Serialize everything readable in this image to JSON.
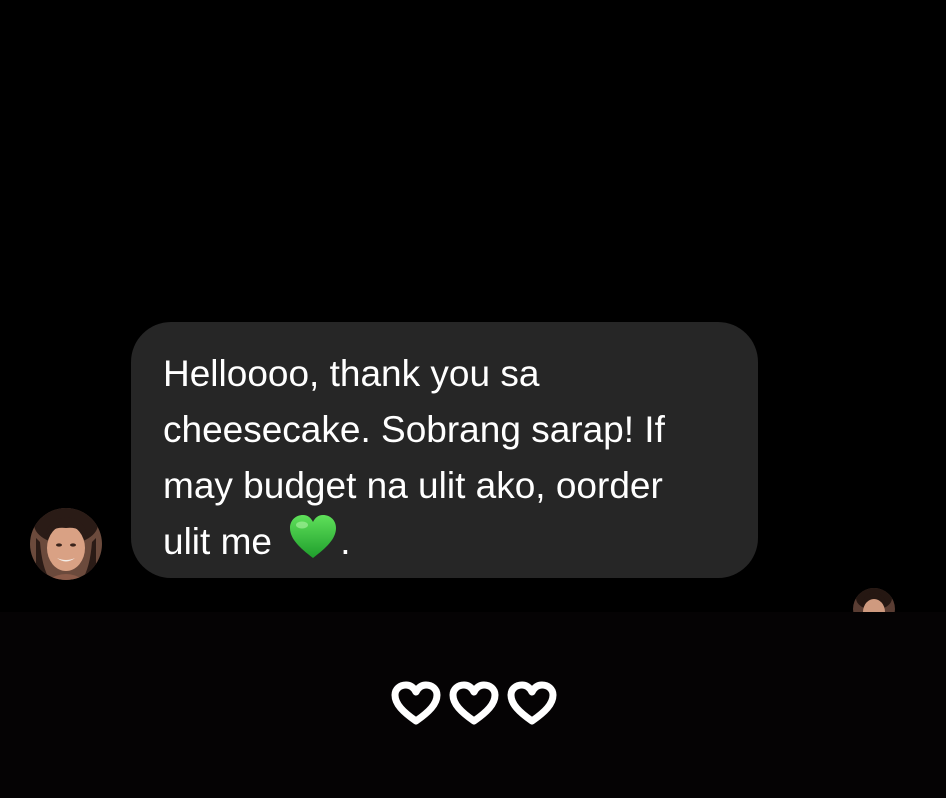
{
  "message": {
    "line1": "Helloooo, thank you sa",
    "line2": "cheesecake. Sobrang sarap! If",
    "line3": "may budget na ulit ako, oorder",
    "line4_before_emoji": "ulit me ",
    "line4_after_emoji": ".",
    "emoji": "green-heart"
  },
  "colors": {
    "background": "#000000",
    "bubble": "#262626",
    "text": "#ffffff",
    "emoji_heart": "#3cc23c",
    "reaction_heart_stroke": "#ffffff"
  },
  "reactions": {
    "icon": "heart-outline-icon",
    "count": 3
  }
}
